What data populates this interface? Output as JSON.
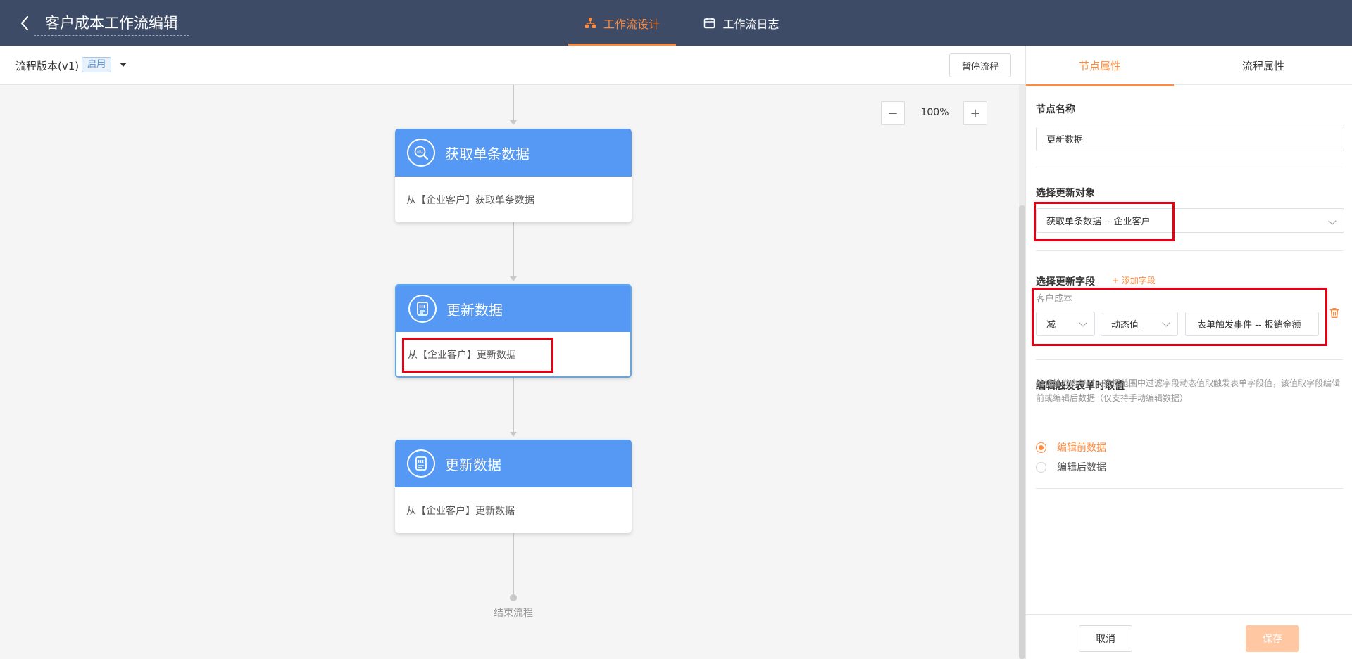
{
  "header": {
    "title": "客户成本工作流编辑",
    "tabs": [
      {
        "label": "工作流设计",
        "active": true,
        "icon": "workflow-icon"
      },
      {
        "label": "工作流日志",
        "active": false,
        "icon": "calendar-icon"
      }
    ]
  },
  "toolbar": {
    "version_label": "流程版本(v1)",
    "status_badge": "启用",
    "pause_button": "暂停流程"
  },
  "canvas": {
    "zoom_out": "−",
    "zoom_in": "+",
    "zoom_level": "100%",
    "nodes": [
      {
        "title": "获取单条数据",
        "desc": "从【企业客户】获取单条数据",
        "icon": "search-data-icon",
        "selected": false
      },
      {
        "title": "更新数据",
        "desc": "从【企业客户】更新数据",
        "icon": "update-data-icon",
        "selected": true
      },
      {
        "title": "更新数据",
        "desc": "从【企业客户】更新数据",
        "icon": "update-data-icon",
        "selected": false
      }
    ],
    "end_label": "结束流程"
  },
  "panel": {
    "tabs": [
      {
        "label": "节点属性",
        "active": true
      },
      {
        "label": "流程属性",
        "active": false
      }
    ],
    "node_name": {
      "title": "节点名称",
      "value": "更新数据"
    },
    "update_target": {
      "title": "选择更新对象",
      "value": "获取单条数据 -- 企业客户"
    },
    "update_fields": {
      "title": "选择更新字段",
      "add_label": "+ 添加字段",
      "field_name": "客户成本",
      "operator": "减",
      "value_type": "动态值",
      "value_source": "表单触发事件 -- 报销金额"
    },
    "edit_trigger": {
      "title": "编辑触发表单时取值",
      "description": "编辑触发表单时，数据范围中过滤字段动态值取触发表单字段值，该值取字段编辑前或编辑后数据（仅支持手动编辑数据）",
      "options": [
        {
          "label": "编辑前数据",
          "checked": true
        },
        {
          "label": "编辑后数据",
          "checked": false
        }
      ]
    },
    "cancel_button": "取消",
    "save_button": "保存"
  },
  "colors": {
    "header_bg": "#3d4b66",
    "accent": "#ff8a3d",
    "node_header": "#5599f4",
    "highlight": "#e60012"
  }
}
